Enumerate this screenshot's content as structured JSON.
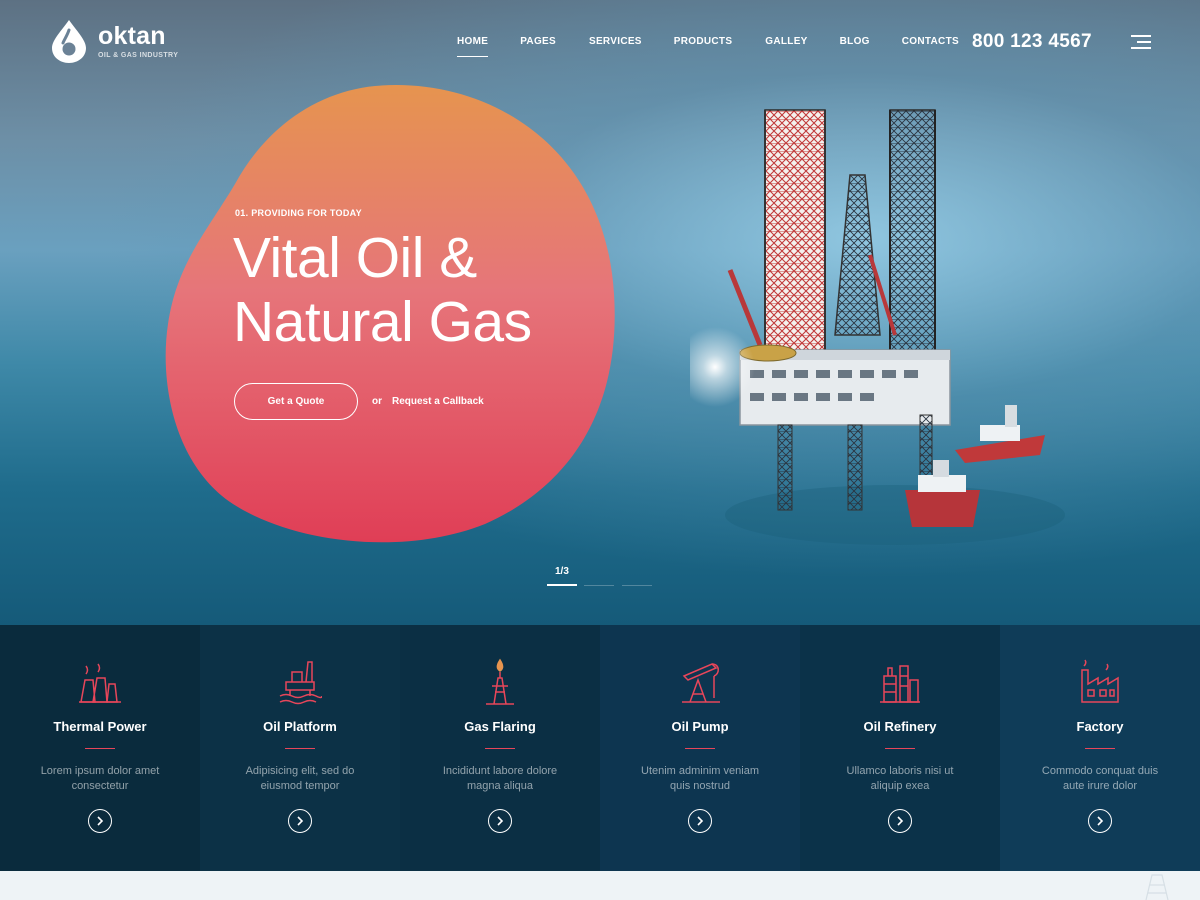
{
  "brand": {
    "name": "oktan",
    "tagline": "OIL & GAS INDUSTRY"
  },
  "nav": {
    "items": [
      {
        "label": "HOME",
        "active": true
      },
      {
        "label": "PAGES"
      },
      {
        "label": "SERVICES"
      },
      {
        "label": "PRODUCTS"
      },
      {
        "label": "GALLEY"
      },
      {
        "label": "BLOG"
      },
      {
        "label": "CONTACTS"
      }
    ],
    "phone": "800 123 4567",
    "menu_icon": "hamburger-icon"
  },
  "hero": {
    "eyebrow": "01. PROVIDING FOR TODAY",
    "headline_line1": "Vital Oil &",
    "headline_line2": "Natural Gas",
    "cta_primary": "Get a Quote",
    "or_text": "or",
    "cta_secondary": "Request a Callback",
    "slide_counter": "1/3",
    "slide_count": 3,
    "active_slide": 1
  },
  "services": [
    {
      "title": "Thermal Power",
      "desc": "Lorem ipsum dolor amet consectetur",
      "icon": "thermal-power-icon"
    },
    {
      "title": "Oil Platform",
      "desc": "Adipisicing elit, sed do eiusmod tempor",
      "icon": "oil-platform-icon"
    },
    {
      "title": "Gas Flaring",
      "desc": "Incididunt labore dolore magna aliqua",
      "icon": "gas-flaring-icon"
    },
    {
      "title": "Oil Pump",
      "desc": "Utenim adminim veniam quis nostrud",
      "icon": "oil-pump-icon"
    },
    {
      "title": "Oil Refinery",
      "desc": "Ullamco laboris nisi ut aliquip exea",
      "icon": "oil-refinery-icon"
    },
    {
      "title": "Factory",
      "desc": "Commodo conquat duis aute irure dolor",
      "icon": "factory-icon"
    }
  ],
  "colors": {
    "accent": "#e7465a",
    "blob_top": "#e6944f",
    "blob_bottom": "#e03e56",
    "service_bg": [
      "#0a2b3d",
      "#0c3146",
      "#0b2f44",
      "#0d3550",
      "#0b3249",
      "#0f3c58"
    ]
  }
}
